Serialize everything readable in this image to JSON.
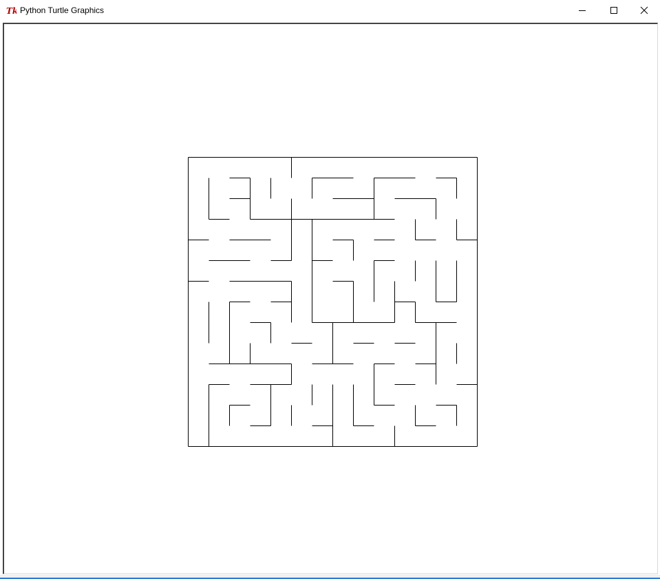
{
  "window": {
    "title": "Python Turtle Graphics",
    "icon": "tk-feather-icon"
  },
  "controls": {
    "minimize": "minimize-icon",
    "maximize": "maximize-icon",
    "close": "close-icon"
  },
  "colors": {
    "pen": "#000000",
    "background": "#ffffff",
    "taskbar_accent": "#2b7bd6",
    "tk_icon": "#b30000"
  }
}
